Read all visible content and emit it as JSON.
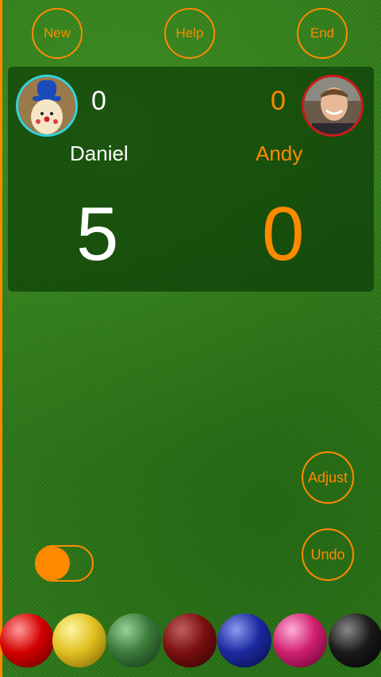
{
  "header": {
    "new_label": "New",
    "help_label": "Help",
    "end_label": "End"
  },
  "players": {
    "left": {
      "name": "Daniel",
      "frames": "0",
      "score": "5"
    },
    "right": {
      "name": "Andy",
      "frames": "0",
      "score": "0"
    }
  },
  "controls": {
    "adjust_label": "Adjust",
    "undo_label": "Undo",
    "toggle_state": "on"
  },
  "balls": [
    "red",
    "yellow",
    "green",
    "brown",
    "blue",
    "pink",
    "black"
  ],
  "colors": {
    "accent": "#ff8a00",
    "felt": "#2f7a1a",
    "left_avatar_ring": "#33d4e0",
    "right_avatar_ring": "#d01818"
  }
}
